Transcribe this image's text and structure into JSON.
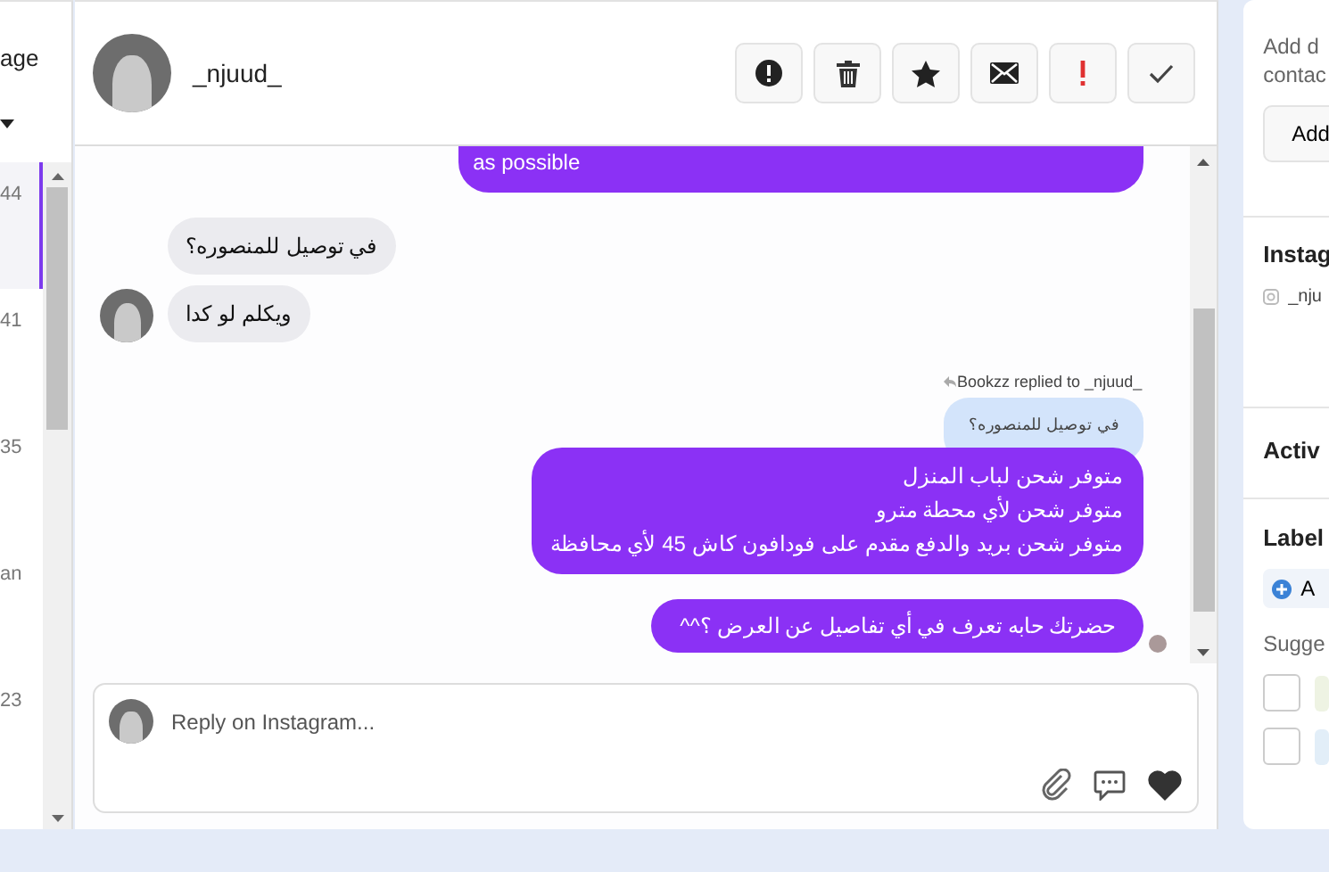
{
  "conversation_list": {
    "heading": "age",
    "items": [
      {
        "time": "44",
        "selected": true
      },
      {
        "time": "41",
        "selected": false
      },
      {
        "time": "35",
        "selected": false
      },
      {
        "time": "an",
        "selected": false
      },
      {
        "time": "23",
        "selected": false
      }
    ]
  },
  "chat": {
    "contact_name": "_njuud_",
    "actions": [
      {
        "kind": "alert"
      },
      {
        "kind": "trash"
      },
      {
        "kind": "star"
      },
      {
        "kind": "mail"
      },
      {
        "kind": "exclaim"
      },
      {
        "kind": "check"
      }
    ],
    "messages": [
      {
        "kind": "outgoing",
        "text": "as possible",
        "cut_top": true,
        "seen": false
      },
      {
        "kind": "incoming",
        "text": "في توصيل للمنصوره؟",
        "avatar": false
      },
      {
        "kind": "incoming",
        "text": "ويكلم لو كدا",
        "avatar": true
      },
      {
        "kind": "reply_note",
        "text": "Bookzz replied to _njuud_"
      },
      {
        "kind": "quoted",
        "text": "في توصيل للمنصوره؟"
      },
      {
        "kind": "outgoing",
        "cut_top": false,
        "seen": false,
        "lines": [
          "متوفر شحن لباب المنزل",
          "متوفر شحن لأي محطة مترو",
          "متوفر شحن بريد والدفع مقدم على فودافون كاش 45 لأي محافظة"
        ]
      },
      {
        "kind": "outgoing",
        "text": "حضرتك حابه تعرف في أي تفاصيل  عن العرض ؟^^",
        "cut_top": false,
        "seen": true
      }
    ],
    "composer": {
      "placeholder": "Reply on Instagram..."
    }
  },
  "details": {
    "about_text": [
      "Add d",
      "contac"
    ],
    "about_button": "Add",
    "instagram_heading": "Instag",
    "instagram_handle": "_nju",
    "activity_heading": "Activ",
    "labels_heading": "Label",
    "add_label": "A",
    "suggested_heading": "Sugge",
    "suggestions": [
      {
        "checked": false,
        "color": "#eef3e3"
      },
      {
        "checked": false,
        "color": "#e2eef8"
      }
    ]
  }
}
